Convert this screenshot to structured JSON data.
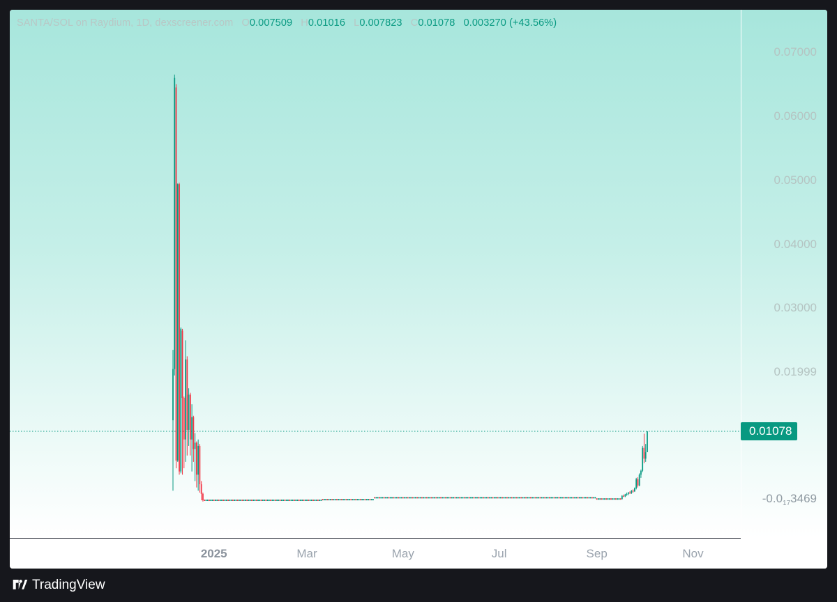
{
  "legend": {
    "symbol": "SANTA/SOL on Raydium, 1D, dexscreener.com",
    "o_label": "O",
    "o_value": "0.007509",
    "h_label": "H",
    "h_value": "0.01016",
    "l_label": "L",
    "l_value": "0.007823",
    "c_label": "C",
    "c_value": "0.01078",
    "change": "0.003270 (+43.56%)"
  },
  "y_axis": {
    "ticks": [
      "0.07000",
      "0.06000",
      "0.05000",
      "0.04000",
      "0.03000",
      "0.01999"
    ],
    "tick_values": [
      0.07,
      0.06,
      0.05,
      0.04,
      0.03,
      0.02
    ],
    "last_price_label": "0.01078",
    "low_label_prefix": "-0.0",
    "low_label_sub": "17",
    "low_label_suffix": "3469"
  },
  "x_axis": {
    "ticks": [
      "2025",
      "Mar",
      "May",
      "Jul",
      "Sep",
      "Nov"
    ]
  },
  "footer": {
    "brand": "TradingView"
  },
  "colors": {
    "up": "#089981",
    "down": "#f23645",
    "last_price_bg": "#089981",
    "background_top": "#a7e6dc",
    "background_bottom": "#ffffff"
  },
  "chart_data": {
    "type": "candlestick",
    "interval": "1D",
    "x_range": [
      "2024-12-06",
      "2025-11-30"
    ],
    "ylim": [
      -0.004,
      0.072
    ],
    "last_price": 0.01078,
    "grid": false,
    "spike": [
      {
        "date": "2024-12-06",
        "o": 0.0125,
        "h": 0.0235,
        "l": 0.0015,
        "c": 0.0205
      },
      {
        "date": "2024-12-07",
        "o": 0.0205,
        "h": 0.0665,
        "l": 0.0195,
        "c": 0.066
      },
      {
        "date": "2024-12-08",
        "o": 0.0645,
        "h": 0.065,
        "l": 0.005,
        "c": 0.0062
      },
      {
        "date": "2024-12-09",
        "o": 0.0062,
        "h": 0.0495,
        "l": 0.006,
        "c": 0.0494
      },
      {
        "date": "2024-12-10",
        "o": 0.0494,
        "h": 0.0496,
        "l": 0.004,
        "c": 0.0045
      },
      {
        "date": "2024-12-11",
        "o": 0.0045,
        "h": 0.027,
        "l": 0.0042,
        "c": 0.0268
      },
      {
        "date": "2024-12-12",
        "o": 0.0265,
        "h": 0.0268,
        "l": 0.004,
        "c": 0.016
      },
      {
        "date": "2024-12-13",
        "o": 0.016,
        "h": 0.0162,
        "l": 0.005,
        "c": 0.0095
      },
      {
        "date": "2024-12-14",
        "o": 0.0095,
        "h": 0.025,
        "l": 0.006,
        "c": 0.022
      },
      {
        "date": "2024-12-15",
        "o": 0.022,
        "h": 0.0225,
        "l": 0.007,
        "c": 0.011
      },
      {
        "date": "2024-12-16",
        "o": 0.011,
        "h": 0.0175,
        "l": 0.0085,
        "c": 0.0165
      },
      {
        "date": "2024-12-17",
        "o": 0.0165,
        "h": 0.0168,
        "l": 0.007,
        "c": 0.0095
      },
      {
        "date": "2024-12-18",
        "o": 0.0095,
        "h": 0.015,
        "l": 0.0045,
        "c": 0.013
      },
      {
        "date": "2024-12-19",
        "o": 0.013,
        "h": 0.0132,
        "l": 0.006,
        "c": 0.008
      },
      {
        "date": "2024-12-20",
        "o": 0.008,
        "h": 0.0105,
        "l": 0.003,
        "c": 0.009
      },
      {
        "date": "2024-12-21",
        "o": 0.009,
        "h": 0.0092,
        "l": 0.002,
        "c": 0.004
      },
      {
        "date": "2024-12-22",
        "o": 0.004,
        "h": 0.0095,
        "l": 0.0015,
        "c": 0.0085
      },
      {
        "date": "2024-12-23",
        "o": 0.0085,
        "h": 0.0088,
        "l": 0.0012,
        "c": 0.0025
      },
      {
        "date": "2024-12-24",
        "o": 0.0025,
        "h": 0.003,
        "l": 0.0,
        "c": 0.001
      },
      {
        "date": "2024-12-25",
        "o": 0.001,
        "h": 0.0012,
        "l": -0.0002,
        "c": 0.0
      }
    ],
    "flat_segments": [
      {
        "from": "2024-12-26",
        "to": "2025-03-10",
        "level": 0.0
      },
      {
        "from": "2025-03-11",
        "to": "2025-04-12",
        "level": 0.0001
      },
      {
        "from": "2025-04-13",
        "to": "2025-08-31",
        "level": 0.0004
      },
      {
        "from": "2025-09-01",
        "to": "2025-09-16",
        "level": 0.0002
      }
    ],
    "recovery": [
      {
        "date": "2025-09-17",
        "o": 0.0002,
        "h": 0.0008,
        "l": 0.0001,
        "c": 0.0007
      },
      {
        "date": "2025-09-18",
        "o": 0.0007,
        "h": 0.0009,
        "l": 0.0005,
        "c": 0.0006
      },
      {
        "date": "2025-09-19",
        "o": 0.0006,
        "h": 0.001,
        "l": 0.0005,
        "c": 0.0009
      },
      {
        "date": "2025-09-20",
        "o": 0.0009,
        "h": 0.0012,
        "l": 0.0007,
        "c": 0.001
      },
      {
        "date": "2025-09-21",
        "o": 0.001,
        "h": 0.0013,
        "l": 0.0008,
        "c": 0.0012
      },
      {
        "date": "2025-09-22",
        "o": 0.0012,
        "h": 0.0014,
        "l": 0.001,
        "c": 0.0011
      },
      {
        "date": "2025-09-23",
        "o": 0.0011,
        "h": 0.0016,
        "l": 0.001,
        "c": 0.0015
      },
      {
        "date": "2025-09-24",
        "o": 0.0015,
        "h": 0.0017,
        "l": 0.0012,
        "c": 0.0014
      },
      {
        "date": "2025-09-25",
        "o": 0.0014,
        "h": 0.002,
        "l": 0.0013,
        "c": 0.0019
      },
      {
        "date": "2025-09-26",
        "o": 0.0019,
        "h": 0.0035,
        "l": 0.0017,
        "c": 0.0033
      },
      {
        "date": "2025-09-27",
        "o": 0.0033,
        "h": 0.0036,
        "l": 0.002,
        "c": 0.0023
      },
      {
        "date": "2025-09-28",
        "o": 0.0023,
        "h": 0.0042,
        "l": 0.0022,
        "c": 0.004
      },
      {
        "date": "2025-09-29",
        "o": 0.004,
        "h": 0.0048,
        "l": 0.0035,
        "c": 0.0046
      },
      {
        "date": "2025-09-30",
        "o": 0.0046,
        "h": 0.0085,
        "l": 0.0044,
        "c": 0.0082
      },
      {
        "date": "2025-10-01",
        "o": 0.0082,
        "h": 0.0104,
        "l": 0.0058,
        "c": 0.0065
      },
      {
        "date": "2025-10-02",
        "o": 0.0065,
        "h": 0.0088,
        "l": 0.006,
        "c": 0.0075
      },
      {
        "date": "2025-10-03",
        "o": 0.007509,
        "h": 0.01016,
        "l": 0.007823,
        "c": 0.01078
      }
    ]
  }
}
